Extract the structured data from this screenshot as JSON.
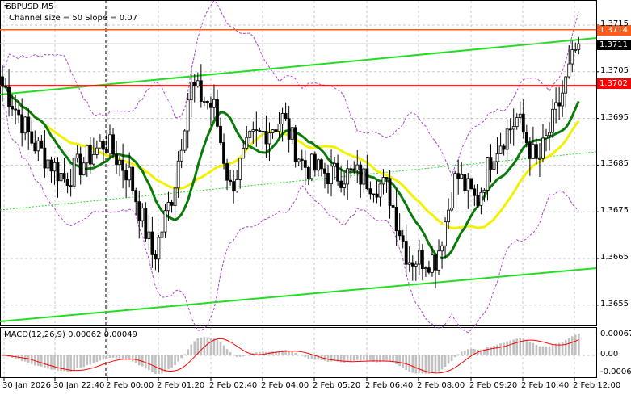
{
  "header": {
    "symbol": "GBPUSD,M5",
    "indicator": "Channel size = 50 Slope = 0.07"
  },
  "price_axis": {
    "ticks": [
      "1.3715",
      "1.3705",
      "1.3695",
      "1.3685",
      "1.3675",
      "1.3665",
      "1.3655"
    ]
  },
  "price_tags": {
    "resistance": "1.3714",
    "current": "1.3711",
    "support": "1.3702"
  },
  "macd": {
    "label": "MACD(12,26,9) 0.00062 0.00049",
    "ticks": [
      "0.00067",
      "0.00",
      "-0.0006"
    ]
  },
  "time_axis": {
    "labels": [
      "30 Jan 2026",
      "30 Jan 22:40",
      "2 Feb 00:00",
      "2 Feb 01:20",
      "2 Feb 02:40",
      "2 Feb 04:00",
      "2 Feb 05:20",
      "2 Feb 06:40",
      "2 Feb 08:00",
      "2 Feb 09:20",
      "2 Feb 10:40",
      "2 Feb 12:00"
    ]
  },
  "colors": {
    "bull": "#000000",
    "bear": "#000000",
    "ma_fast": "#0a7a0a",
    "ma_slow": "#f2f200",
    "channel": "#22dd22",
    "support": "#ff0000",
    "resistance": "#ff5a1a",
    "bands": "#b040d0",
    "macd_hist": "#c0c0c0",
    "macd_signal": "#ff0000"
  },
  "chart_data": {
    "type": "candlestick",
    "symbol": "GBPUSD",
    "timeframe": "M5",
    "ylim": [
      1.365,
      1.372
    ],
    "levels": {
      "resistance": 1.3714,
      "support": 1.3702,
      "last": 1.3711
    },
    "path_key_prices": [
      1.3702,
      1.369,
      1.3682,
      1.369,
      1.3683,
      1.3665,
      1.368,
      1.3702,
      1.3697,
      1.368,
      1.369,
      1.3695,
      1.3685,
      1.3683,
      1.3683,
      1.368,
      1.3665,
      1.3665,
      1.3683,
      1.3677,
      1.3688,
      1.3695,
      1.3685,
      1.3697,
      1.3711
    ]
  }
}
